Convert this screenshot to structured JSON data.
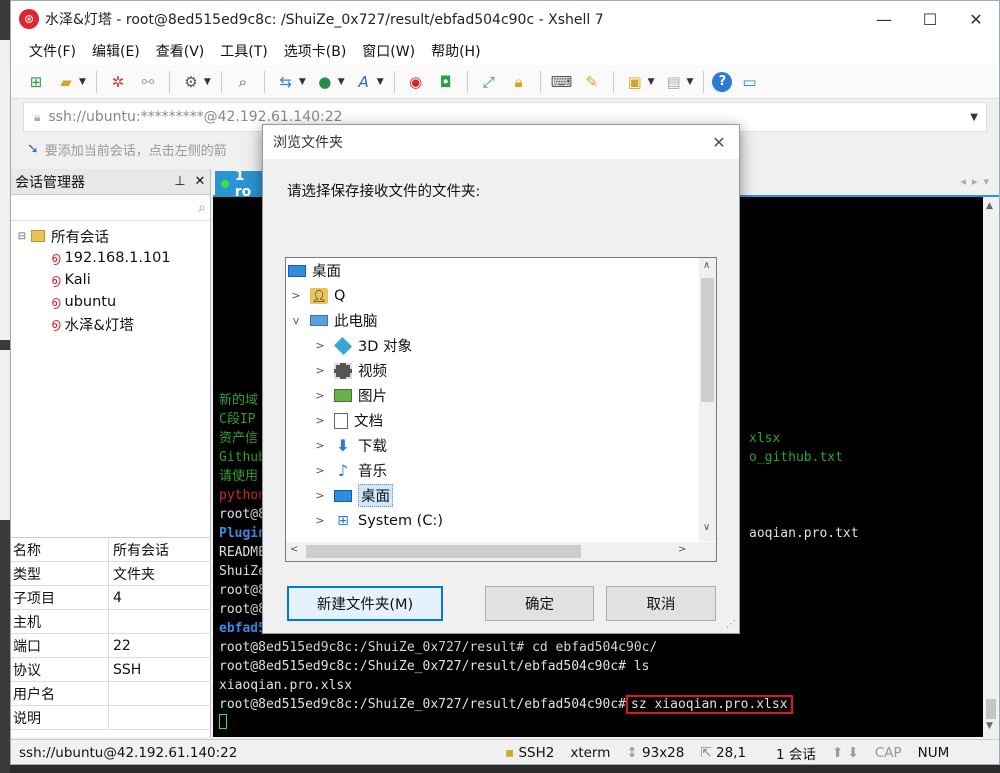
{
  "window": {
    "title": "水泽&灯塔 - root@8ed515ed9c8c: /ShuiZe_0x727/result/ebfad504c90c - Xshell 7",
    "app_icon": "xshell-logo-icon",
    "minimize": "—",
    "maximize": "☐",
    "close": "✕"
  },
  "menu": [
    "文件(F)",
    "编辑(E)",
    "查看(V)",
    "工具(T)",
    "选项卡(B)",
    "窗口(W)",
    "帮助(H)"
  ],
  "address_bar": {
    "value": "ssh://ubuntu:*********@42.192.61.140:22"
  },
  "hint_bar": {
    "text": "要添加当前会话，点击左侧的箭"
  },
  "session_manager": {
    "title": "会话管理器",
    "pin": "⊥",
    "close": "✕",
    "root_label": "所有会话",
    "sessions": [
      "192.168.1.101",
      "Kali",
      "ubuntu",
      "水泽&灯塔"
    ]
  },
  "properties": [
    {
      "key": "名称",
      "value": "所有会话"
    },
    {
      "key": "类型",
      "value": "文件夹"
    },
    {
      "key": "子项目",
      "value": "4"
    },
    {
      "key": "主机",
      "value": ""
    },
    {
      "key": "端口",
      "value": "22"
    },
    {
      "key": "协议",
      "value": "SSH"
    },
    {
      "key": "用户名",
      "value": ""
    },
    {
      "key": "说明",
      "value": ""
    }
  ],
  "tab": {
    "label": "1 ro"
  },
  "terminal": {
    "lines": [
      {
        "text": "新的域",
        "cls": "g"
      },
      {
        "text": "C段IP",
        "cls": "g"
      },
      {
        "text": "资产信",
        "cls": "g"
      },
      {
        "text": "Github",
        "cls": "g"
      },
      {
        "text": "请使用",
        "cls": "g"
      },
      {
        "text": "python",
        "cls": "r"
      },
      {
        "text": "root@8",
        "cls": ""
      },
      {
        "text": "Plugin",
        "cls": "b"
      },
      {
        "text": "README",
        "cls": ""
      },
      {
        "text": "ShuiZe",
        "cls": ""
      },
      {
        "text": "root@8",
        "cls": ""
      },
      {
        "text": "root@8",
        "cls": ""
      },
      {
        "text": "ebfad5",
        "cls": "b"
      }
    ],
    "right_fragments": [
      {
        "text": "xlsx",
        "cls": "g"
      },
      {
        "text": "o_github.txt",
        "cls": "g"
      },
      {
        "text": "aoqian.pro.txt",
        "cls": ""
      }
    ],
    "cd_line": "root@8ed515ed9c8c:/ShuiZe_0x727/result# cd ebfad504c90c/",
    "ls_line": "root@8ed515ed9c8c:/ShuiZe_0x727/result/ebfad504c90c# ls",
    "file_line": "xiaoqian.pro.xlsx",
    "prompt_line": "root@8ed515ed9c8c:/ShuiZe_0x727/result/ebfad504c90c#",
    "command": "sz xiaoqian.pro.xlsx"
  },
  "status_bar": {
    "connection": "ssh://ubuntu@42.192.61.140:22",
    "protocol": "SSH2",
    "term": "xterm",
    "size": "93x28",
    "cursor": "28,1",
    "sessions": "1 会话",
    "cap": "CAP",
    "num": "NUM"
  },
  "dialog": {
    "title": "浏览文件夹",
    "prompt": "请选择保存接收文件的文件夹:",
    "tree": [
      {
        "label": "桌面",
        "icon": "desktop-icon",
        "level": 0,
        "expander": ""
      },
      {
        "label": "Q",
        "icon": "user-folder-icon",
        "level": 1,
        "expander": ">"
      },
      {
        "label": "此电脑",
        "icon": "computer-icon",
        "level": 1,
        "expander": "v"
      },
      {
        "label": "3D 对象",
        "icon": "3d-objects-icon",
        "level": 2,
        "expander": ">"
      },
      {
        "label": "视频",
        "icon": "video-icon",
        "level": 2,
        "expander": ">"
      },
      {
        "label": "图片",
        "icon": "pictures-icon",
        "level": 2,
        "expander": ">"
      },
      {
        "label": "文档",
        "icon": "documents-icon",
        "level": 2,
        "expander": ">"
      },
      {
        "label": "下载",
        "icon": "downloads-icon",
        "level": 2,
        "expander": ">"
      },
      {
        "label": "音乐",
        "icon": "music-icon",
        "level": 2,
        "expander": ">"
      },
      {
        "label": "桌面",
        "icon": "desktop-icon",
        "level": 2,
        "expander": ">",
        "selected": true
      },
      {
        "label": "System (C:)",
        "icon": "drive-icon",
        "level": 2,
        "expander": ">"
      }
    ],
    "new_folder_button": "新建文件夹(M)",
    "ok_button": "确定",
    "cancel_button": "取消"
  }
}
